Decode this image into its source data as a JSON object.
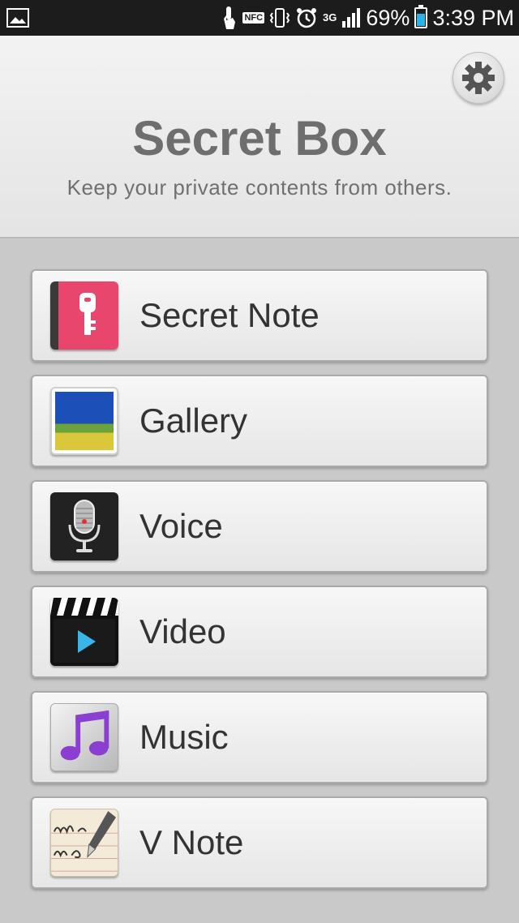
{
  "status_bar": {
    "nfc": "NFC",
    "network": "3G",
    "battery": "69%",
    "time": "3:39 PM",
    "battery_level": 0.69
  },
  "header": {
    "title": "Secret Box",
    "subtitle": "Keep your private contents from others."
  },
  "items": [
    {
      "label": "Secret Note",
      "icon": "secret-note-icon"
    },
    {
      "label": "Gallery",
      "icon": "gallery-icon"
    },
    {
      "label": "Voice",
      "icon": "voice-recorder-icon"
    },
    {
      "label": "Video",
      "icon": "video-icon"
    },
    {
      "label": "Music",
      "icon": "music-icon"
    },
    {
      "label": "V Note",
      "icon": "v-note-icon"
    }
  ],
  "colors": {
    "secret_note_accent": "#e8466d",
    "battery_fill": "#2ab3e8"
  }
}
